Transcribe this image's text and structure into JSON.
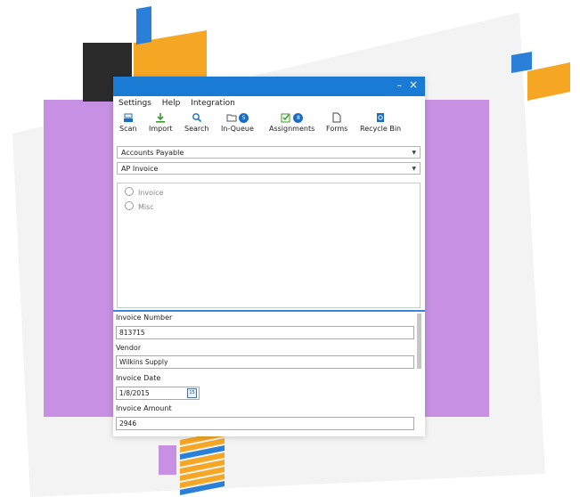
{
  "colors": {
    "titlebar": "#1a7bd4",
    "accent_blue": "#2a7fd8",
    "accent_orange": "#f5a623",
    "accent_purple": "#c790e2",
    "dark": "#2b2b2b"
  },
  "window": {
    "minimize_glyph": "–",
    "close_glyph": "×"
  },
  "menu": {
    "settings": "Settings",
    "help": "Help",
    "integration": "Integration"
  },
  "toolbar": {
    "scan": "Scan",
    "import": "Import",
    "search": "Search",
    "in_queue": "In-Queue",
    "in_queue_badge": "5",
    "assignments": "Assignments",
    "assignments_badge": "8",
    "forms": "Forms",
    "recycle_bin": "Recycle Bin"
  },
  "department_select": {
    "value": "Accounts Payable"
  },
  "doc_type_select": {
    "value": "AP Invoice"
  },
  "options": [
    {
      "label": "Invoice"
    },
    {
      "label": "Misc"
    }
  ],
  "fields": {
    "invoice_number_label": "Invoice Number",
    "invoice_number_value": "813715",
    "vendor_label": "Vendor",
    "vendor_value": "Wilkins Supply",
    "invoice_date_label": "Invoice Date",
    "invoice_date_value": "1/8/2015",
    "calendar_day": "15",
    "invoice_amount_label": "Invoice Amount",
    "invoice_amount_value": "2946"
  }
}
